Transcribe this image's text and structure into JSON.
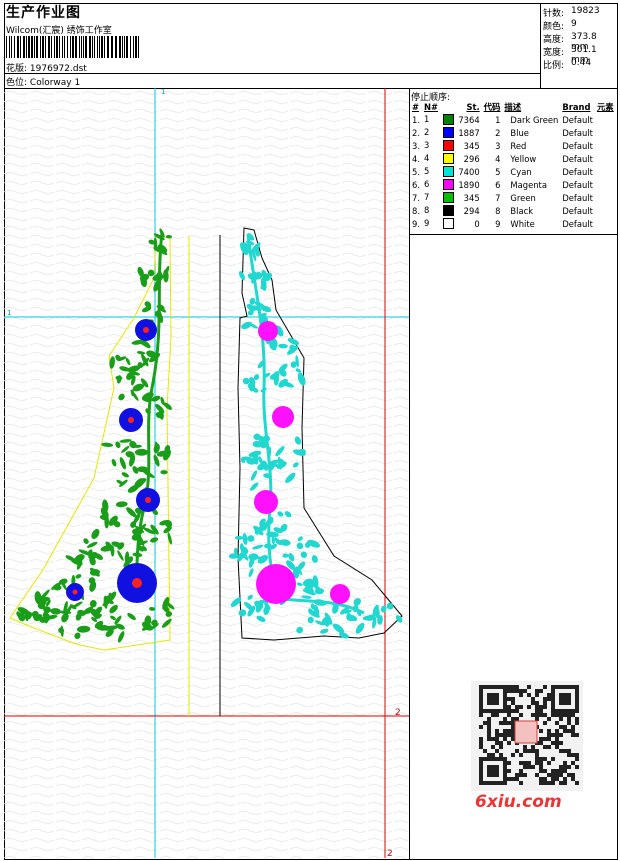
{
  "header": {
    "title": "生产作业图",
    "company": "Wilcom(汇宸) 绣饰工作室",
    "design_label": "花版:",
    "design_value": "1976972.dst",
    "colorway_label": "色位:",
    "colorway_value": "Colorway 1"
  },
  "stats": {
    "stitches_label": "针数:",
    "stitches": "19823",
    "colors_label": "颜色:",
    "colors": "9",
    "height_label": "高度:",
    "height": "373.8 mm",
    "width_label": "宽度:",
    "width": "301.1 mm",
    "scale_label": "比例:",
    "scale": "0.44"
  },
  "sequence": {
    "title": "停止顺序:",
    "headers": {
      "idx": "#",
      "no": "N#",
      "st": "St.",
      "code": "代码",
      "desc": "描述",
      "brand": "Brand",
      "elem": "元素"
    },
    "rows": [
      {
        "idx": "1.",
        "no": "1",
        "color": "#008000",
        "st": "7364",
        "code": "1",
        "desc": "Dark Green",
        "brand": "Default"
      },
      {
        "idx": "2.",
        "no": "2",
        "color": "#0000ff",
        "st": "1887",
        "code": "2",
        "desc": "Blue",
        "brand": "Default"
      },
      {
        "idx": "3.",
        "no": "3",
        "color": "#ff0000",
        "st": "345",
        "code": "3",
        "desc": "Red",
        "brand": "Default"
      },
      {
        "idx": "4.",
        "no": "4",
        "color": "#ffff00",
        "st": "296",
        "code": "4",
        "desc": "Yellow",
        "brand": "Default"
      },
      {
        "idx": "5.",
        "no": "5",
        "color": "#00e5d6",
        "st": "7400",
        "code": "5",
        "desc": "Cyan",
        "brand": "Default"
      },
      {
        "idx": "6.",
        "no": "6",
        "color": "#ff00ff",
        "st": "1890",
        "code": "6",
        "desc": "Magenta",
        "brand": "Default"
      },
      {
        "idx": "7.",
        "no": "7",
        "color": "#00c000",
        "st": "345",
        "code": "7",
        "desc": "Green",
        "brand": "Default"
      },
      {
        "idx": "8.",
        "no": "8",
        "color": "#000000",
        "st": "294",
        "code": "8",
        "desc": "Black",
        "brand": "Default"
      },
      {
        "idx": "9.",
        "no": "9",
        "color": "#ffffff",
        "st": "0",
        "code": "9",
        "desc": "White",
        "brand": "Default"
      }
    ]
  },
  "guides": {
    "cyan_marker": "1",
    "red_marker": "2"
  },
  "watermark": {
    "site": "6xiu.com"
  }
}
